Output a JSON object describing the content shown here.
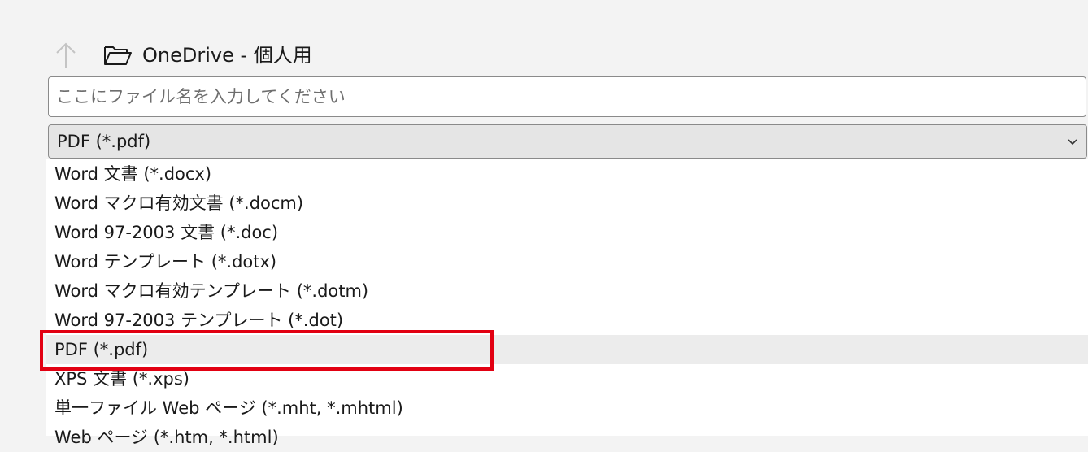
{
  "header": {
    "location": "OneDrive - 個人用",
    "up_icon": "arrow-up-icon",
    "folder_icon": "folder-open-icon"
  },
  "filename_input": {
    "value": "",
    "placeholder": "ここにファイル名を入力してください"
  },
  "filetype_select": {
    "selected": "PDF (*.pdf)",
    "chevron_icon": "chevron-down-icon"
  },
  "filetype_options": [
    "Word 文書 (*.docx)",
    "Word マクロ有効文書 (*.docm)",
    "Word 97-2003 文書 (*.doc)",
    "Word テンプレート (*.dotx)",
    "Word マクロ有効テンプレート (*.dotm)",
    "Word 97-2003 テンプレート (*.dot)",
    "PDF (*.pdf)",
    "XPS 文書 (*.xps)",
    "単一ファイル Web ページ (*.mht, *.mhtml)",
    "Web ページ (*.htm, *.html)"
  ],
  "colors": {
    "highlight_border": "#e20012",
    "selected_row": "#ececec"
  }
}
